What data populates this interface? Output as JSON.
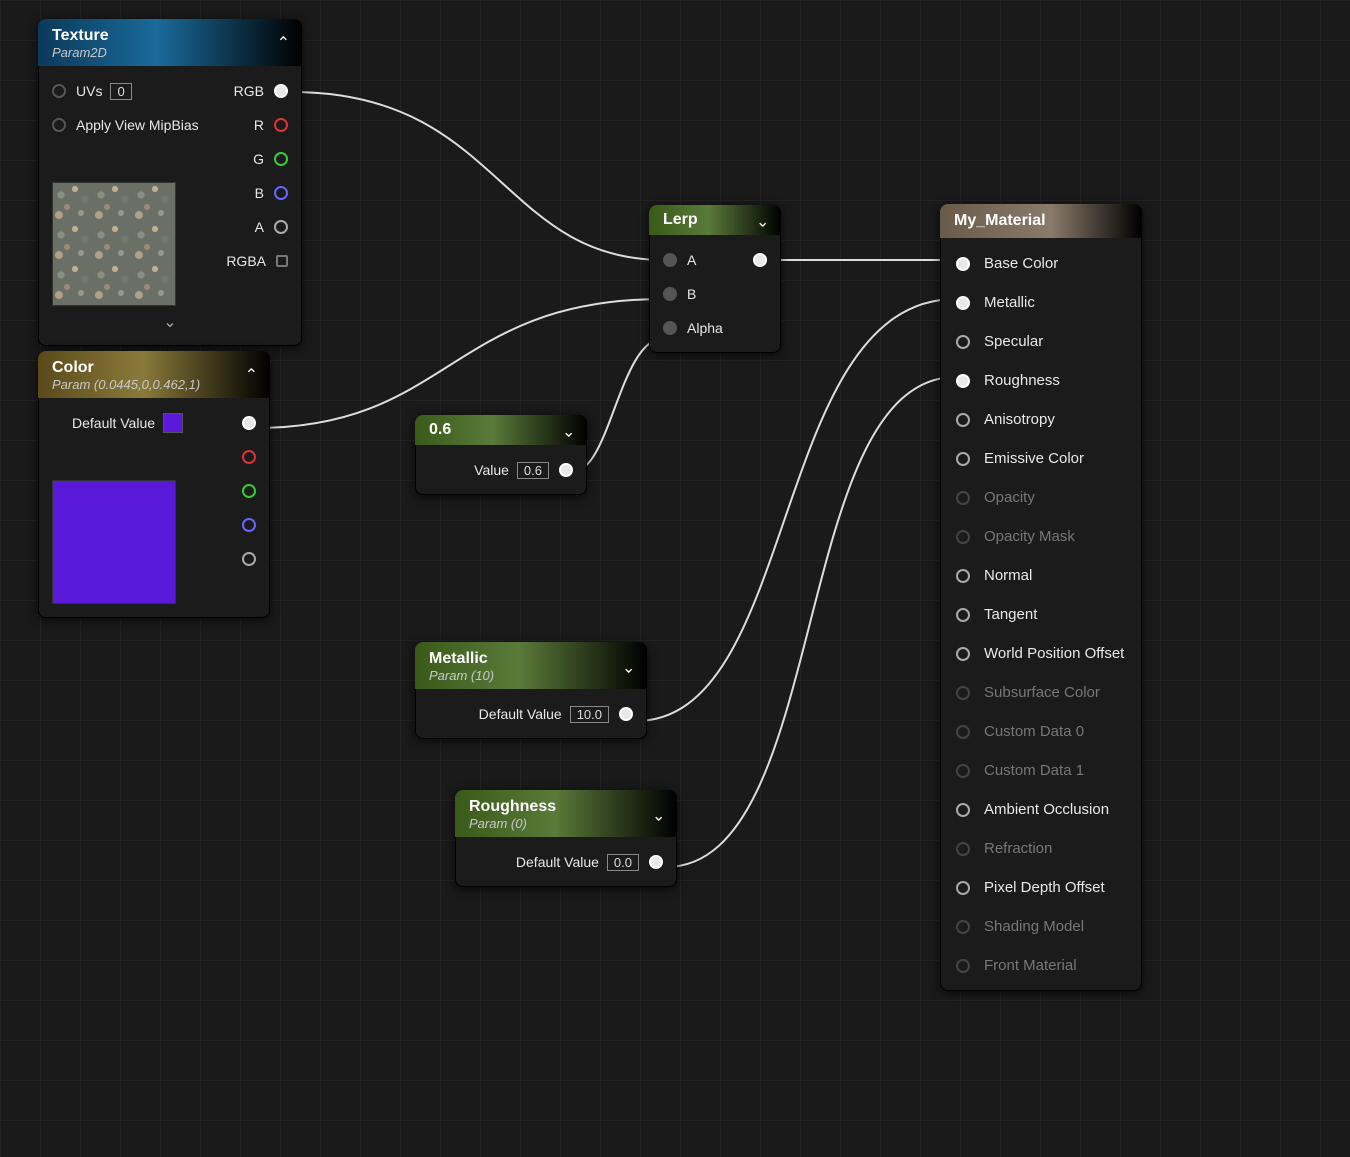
{
  "texture_node": {
    "title": "Texture",
    "sub": "Param2D",
    "uvs_label": "UVs",
    "uvs_value": "0",
    "mip_label": "Apply View MipBias",
    "out_rgb": "RGB",
    "out_r": "R",
    "out_g": "G",
    "out_b": "B",
    "out_a": "A",
    "out_rgba": "RGBA"
  },
  "color_node": {
    "title": "Color",
    "sub": "Param (0.0445,0,0.462,1)",
    "default_label": "Default Value",
    "swatch_color": "#5a18d8"
  },
  "lerp_node": {
    "title": "Lerp",
    "in_a": "A",
    "in_b": "B",
    "in_alpha": "Alpha"
  },
  "scalar_node": {
    "title": "0.6",
    "value_label": "Value",
    "value": "0.6"
  },
  "metallic_node": {
    "title": "Metallic",
    "sub": "Param (10)",
    "default_label": "Default Value",
    "value": "10.0"
  },
  "roughness_node": {
    "title": "Roughness",
    "sub": "Param (0)",
    "default_label": "Default Value",
    "value": "0.0"
  },
  "material_node": {
    "title": "My_Material",
    "pins": [
      {
        "label": "Base Color",
        "active": true,
        "connected": true
      },
      {
        "label": "Metallic",
        "active": true,
        "connected": true
      },
      {
        "label": "Specular",
        "active": true,
        "connected": false
      },
      {
        "label": "Roughness",
        "active": true,
        "connected": true
      },
      {
        "label": "Anisotropy",
        "active": true,
        "connected": false
      },
      {
        "label": "Emissive Color",
        "active": true,
        "connected": false
      },
      {
        "label": "Opacity",
        "active": false,
        "connected": false
      },
      {
        "label": "Opacity Mask",
        "active": false,
        "connected": false
      },
      {
        "label": "Normal",
        "active": true,
        "connected": false
      },
      {
        "label": "Tangent",
        "active": true,
        "connected": false
      },
      {
        "label": "World Position Offset",
        "active": true,
        "connected": false
      },
      {
        "label": "Subsurface Color",
        "active": false,
        "connected": false
      },
      {
        "label": "Custom Data 0",
        "active": false,
        "connected": false
      },
      {
        "label": "Custom Data 1",
        "active": false,
        "connected": false
      },
      {
        "label": "Ambient Occlusion",
        "active": true,
        "connected": false
      },
      {
        "label": "Refraction",
        "active": false,
        "connected": false
      },
      {
        "label": "Pixel Depth Offset",
        "active": true,
        "connected": false
      },
      {
        "label": "Shading Model",
        "active": false,
        "connected": false
      },
      {
        "label": "Front Material",
        "active": false,
        "connected": false
      }
    ]
  }
}
